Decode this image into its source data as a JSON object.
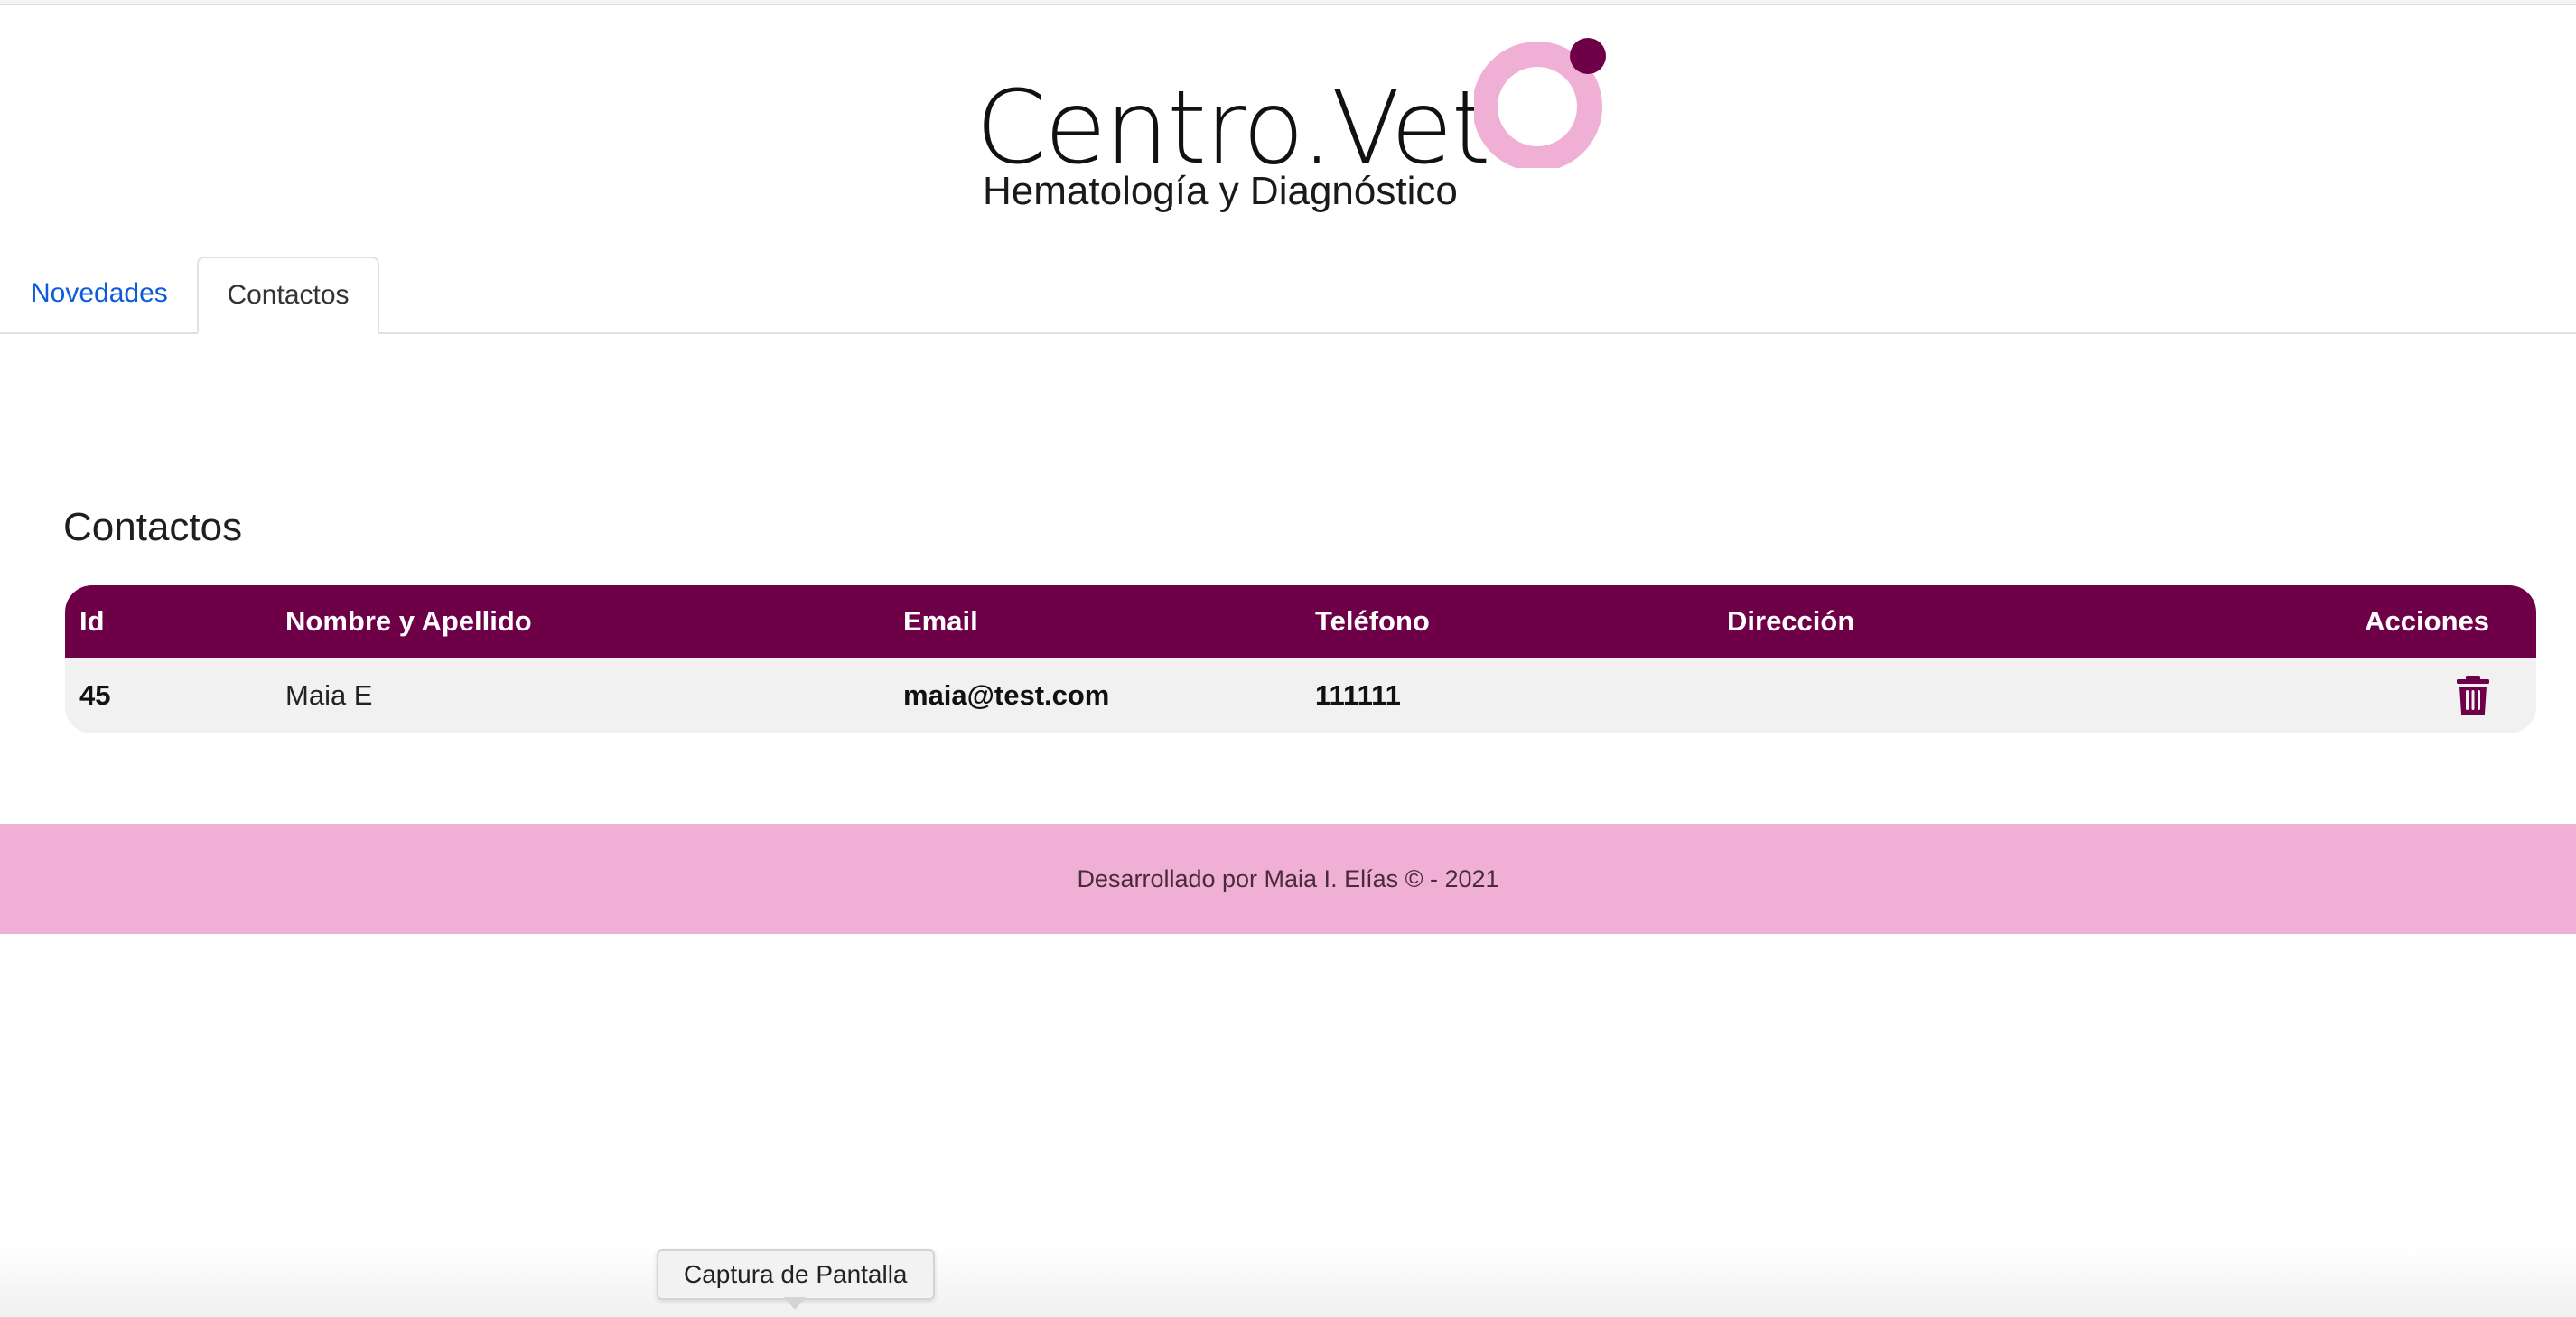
{
  "brand": {
    "name": "Centro.Vet",
    "subtitle": "Hematología y Diagnóstico",
    "colors": {
      "primary": "#6e0048",
      "accent_pink": "#f0b0d5",
      "link_blue": "#0d5bdb"
    }
  },
  "tabs": [
    {
      "label": "Novedades",
      "active": false
    },
    {
      "label": "Contactos",
      "active": true
    }
  ],
  "main": {
    "title": "Contactos",
    "table": {
      "columns": [
        "Id",
        "Nombre y Apellido",
        "Email",
        "Teléfono",
        "Dirección",
        "Acciones"
      ],
      "rows": [
        {
          "id": "45",
          "nombre": "Maia E",
          "email": "maia@test.com",
          "telefono": "111111",
          "direccion": "",
          "action_icon": "trash-icon"
        }
      ]
    }
  },
  "footer": {
    "text": "Desarrollado por Maia I. Elías © - 2021"
  },
  "tooltip": {
    "text": "Captura de Pantalla"
  }
}
